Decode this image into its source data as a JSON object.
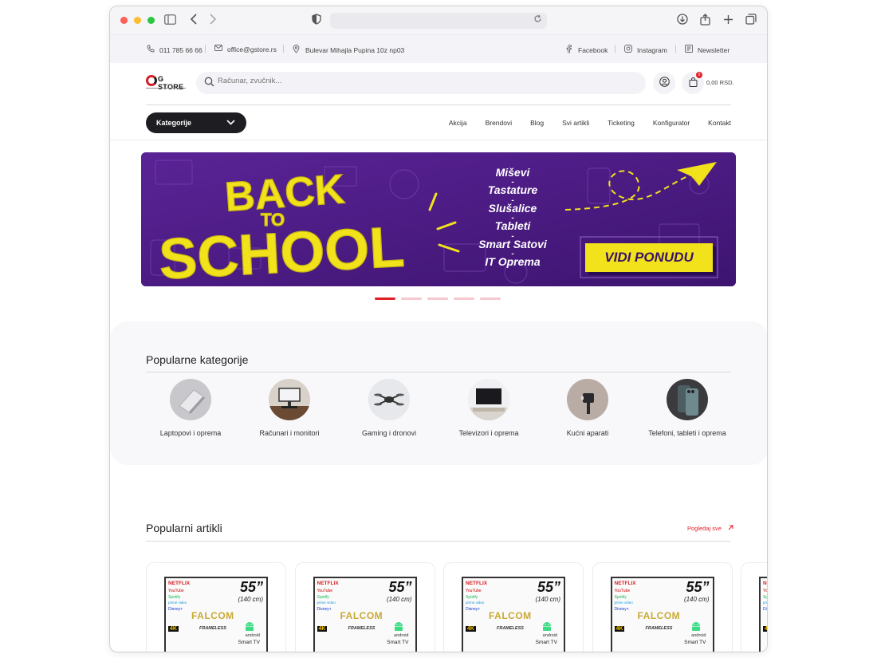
{
  "browser": {
    "url": "",
    "icons": [
      "sidebar-icon",
      "back-icon",
      "forward-icon",
      "shield-icon",
      "reload-icon",
      "download-icon",
      "share-icon",
      "new-tab-icon",
      "tabs-icon"
    ]
  },
  "topbar": {
    "phone": "011 785 66 66",
    "email": "office@gstore.rs",
    "address": "Bulevar Mihajla Pupina 10z np03",
    "facebook": "Facebook",
    "instagram": "Instagram",
    "newsletter": "Newsletter"
  },
  "header": {
    "logo_text": "G STORE",
    "search_placeholder": "Računar, zvučnik...",
    "cart_count": "0",
    "cart_total": "0,00 RSD."
  },
  "nav": {
    "categories_button": "Kategorije",
    "links": [
      "Akcija",
      "Brendovi",
      "Blog",
      "Svi artikli",
      "Ticketing",
      "Konfigurator",
      "Kontakt"
    ]
  },
  "hero": {
    "headline_1": "BACK",
    "headline_2": "TO",
    "headline_3": "SCHOOL",
    "items": [
      "Miševi",
      "Tastature",
      "Slušalice",
      "Tableti",
      "Smart Satovi",
      "IT Oprema"
    ],
    "cta": "VIDI PONUDU",
    "slides": 5,
    "active_slide": 1
  },
  "popular_categories": {
    "title": "Popularne kategorije",
    "items": [
      {
        "label": "Laptopovi i oprema"
      },
      {
        "label": "Računari i monitori"
      },
      {
        "label": "Gaming i dronovi"
      },
      {
        "label": "Televizori i oprema"
      },
      {
        "label": "Kućni aparati"
      },
      {
        "label": "Telefoni, tableti i oprema"
      }
    ]
  },
  "popular_products": {
    "title": "Popularni artikli",
    "see_all": "Pogledaj sve",
    "card_text": {
      "netflix": "NETFLIX",
      "youtube": "YouTube",
      "spotify": "Spotify",
      "prime": "prime video",
      "disney": "Disney+",
      "size": "55”",
      "size_cm": "(140 cm)",
      "brand": "FALCOM",
      "frameless": "FRAMELESS",
      "os": "android",
      "smart": "Smart TV",
      "res": "4K"
    },
    "count": 5
  },
  "colors": {
    "accent": "#e21f26",
    "hero_bg": "#4b1d86",
    "hero_yellow": "#f2e21b",
    "dark": "#1d1d22"
  }
}
